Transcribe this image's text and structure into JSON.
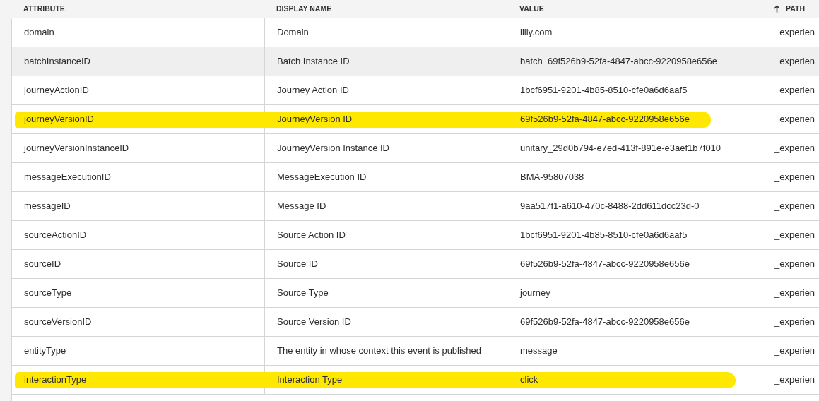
{
  "table": {
    "columns": [
      {
        "label": "ATTRIBUTE",
        "sorted": false
      },
      {
        "label": "DISPLAY NAME",
        "sorted": false
      },
      {
        "label": "VALUE",
        "sorted": false
      },
      {
        "label": "PATH",
        "sorted": true
      }
    ],
    "rows": [
      {
        "attribute": "domain",
        "display_name": "Domain",
        "value": "lilly.com",
        "path": "_experien",
        "hovered": false,
        "highlighted": false
      },
      {
        "attribute": "batchInstanceID",
        "display_name": "Batch Instance ID",
        "value": "batch_69f526b9-52fa-4847-abcc-9220958e656e",
        "path": "_experien",
        "hovered": true,
        "highlighted": false
      },
      {
        "attribute": "journeyActionID",
        "display_name": "Journey Action ID",
        "value": "1bcf6951-9201-4b85-8510-cfe0a6d6aaf5",
        "path": "_experien",
        "hovered": false,
        "highlighted": false
      },
      {
        "attribute": "journeyVersionID",
        "display_name": "JourneyVersion ID",
        "value": "69f526b9-52fa-4847-abcc-9220958e656e",
        "path": "_experien",
        "hovered": false,
        "highlighted": true
      },
      {
        "attribute": "journeyVersionInstanceID",
        "display_name": "JourneyVersion Instance ID",
        "value": "unitary_29d0b794-e7ed-413f-891e-e3aef1b7f010",
        "path": "_experien",
        "hovered": false,
        "highlighted": false
      },
      {
        "attribute": "messageExecutionID",
        "display_name": "MessageExecution ID",
        "value": "BMA-95807038",
        "path": "_experien",
        "hovered": false,
        "highlighted": false
      },
      {
        "attribute": "messageID",
        "display_name": "Message ID",
        "value": "9aa517f1-a610-470c-8488-2dd611dcc23d-0",
        "path": "_experien",
        "hovered": false,
        "highlighted": false
      },
      {
        "attribute": "sourceActionID",
        "display_name": "Source Action ID",
        "value": "1bcf6951-9201-4b85-8510-cfe0a6d6aaf5",
        "path": "_experien",
        "hovered": false,
        "highlighted": false
      },
      {
        "attribute": "sourceID",
        "display_name": "Source ID",
        "value": "69f526b9-52fa-4847-abcc-9220958e656e",
        "path": "_experien",
        "hovered": false,
        "highlighted": false
      },
      {
        "attribute": "sourceType",
        "display_name": "Source Type",
        "value": "journey",
        "path": "_experien",
        "hovered": false,
        "highlighted": false
      },
      {
        "attribute": "sourceVersionID",
        "display_name": "Source Version ID",
        "value": "69f526b9-52fa-4847-abcc-9220958e656e",
        "path": "_experien",
        "hovered": false,
        "highlighted": false
      },
      {
        "attribute": "entityType",
        "display_name": "The entity in whose context this event is published",
        "value": "message",
        "path": "_experien",
        "hovered": false,
        "highlighted": false
      },
      {
        "attribute": "interactionType",
        "display_name": "Interaction Type",
        "value": "click",
        "path": "_experien",
        "hovered": false,
        "highlighted": true
      }
    ]
  }
}
